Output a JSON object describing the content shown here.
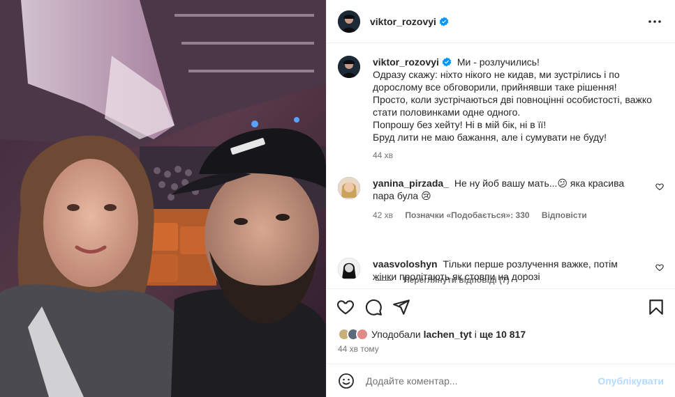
{
  "post": {
    "author": "viktor_rozovyi",
    "verified": true,
    "more_icon": "more-horizontal-icon"
  },
  "caption": {
    "username": "viktor_rozovyi",
    "lines": [
      "Ми - розлучились!",
      "Одразу скажу: ніхто нікого не кидав, ми зустрілись і по",
      "дорослому все обговорили, прийнявши таке рішення!",
      "Просто, коли зустрічаються дві повноцінні особистості, важко",
      "стати половинками одне одного.",
      "Попрошу без хейту! Ні в мій бік, ні в її!",
      "Бруд лити не маю бажання, але і сумувати не буду!"
    ],
    "time": "44 хв"
  },
  "comments": [
    {
      "username": "yanina_pirzada_",
      "text": "Не ну йоб вашу мать...😕 яка красива пара була 😢",
      "time": "42 хв",
      "likes": "Позначки «Подобається»: 330",
      "reply": "Відповісти",
      "view_replies": "Переглянути відповіді (7)"
    },
    {
      "username": "vaasvoloshyn",
      "text": "Тільки перше розлучення важке, потім жінки пролітають як стовпи на дорозі"
    }
  ],
  "likes": {
    "prefix": "Уподобали",
    "user": "lachen_tyt",
    "connector": "і",
    "rest": "ще 10 817"
  },
  "timestamp": "44 хв тому",
  "add_comment": {
    "placeholder": "Додайте коментар...",
    "publish": "Опублікувати"
  },
  "colors": {
    "verified": "#0095f6",
    "muted": "#737373",
    "publish_disabled": "#b3dbff",
    "text": "#262626"
  }
}
